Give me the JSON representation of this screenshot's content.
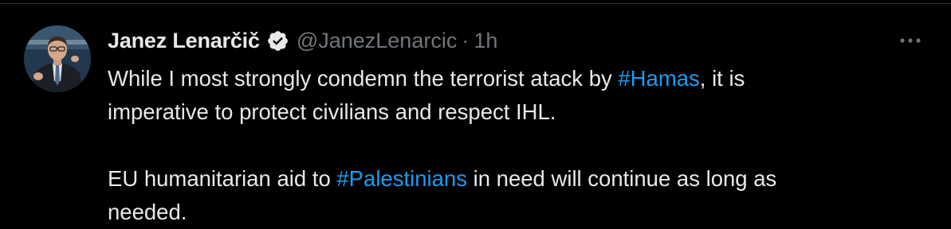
{
  "tweet": {
    "author": {
      "name": "Janez Lenarčič",
      "handle": "@JanezLenarcic",
      "separator": "·",
      "time": "1h",
      "verified_icon": "verified-badge-icon"
    },
    "more_icon": "more-options-icon",
    "paragraph1": {
      "before": "While I most strongly condemn the terrorist atack by ",
      "hashtag": "#Hamas",
      "after_line1": ", it is",
      "line2": "imperative to protect civilians and respect IHL."
    },
    "paragraph2": {
      "before": "EU humanitarian aid to ",
      "hashtag": "#Palestinians",
      "after": " in need will continue as long as",
      "line2": "needed."
    }
  },
  "colors": {
    "background": "#000000",
    "text": "#e7e9ea",
    "secondary": "#71767b",
    "link": "#1d9bf0",
    "badge": "#e7e9ea"
  }
}
